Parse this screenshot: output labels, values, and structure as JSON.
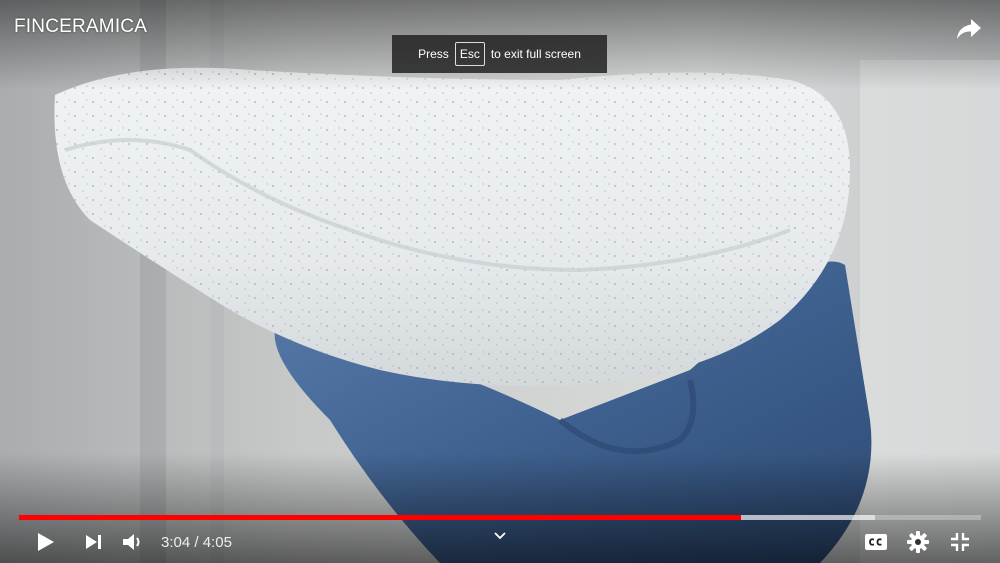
{
  "video": {
    "title": "FINCERAMICA"
  },
  "toast": {
    "prefix": "Press",
    "key": "Esc",
    "suffix": "to exit full screen"
  },
  "playback": {
    "current_time": "3:04",
    "separator": " / ",
    "duration": "4:05",
    "played_fraction": 0.751,
    "buffered_fraction": 0.89
  },
  "icons": {
    "share": "share-arrow-icon",
    "play": "play-icon",
    "next": "next-track-icon",
    "volume": "volume-icon",
    "chevron": "chevron-down-icon",
    "captions": "closed-captions-icon",
    "settings": "gear-icon",
    "exit_fullscreen": "exit-fullscreen-icon"
  },
  "colors": {
    "progress_played": "#ff0000",
    "icon": "#ffffff"
  }
}
